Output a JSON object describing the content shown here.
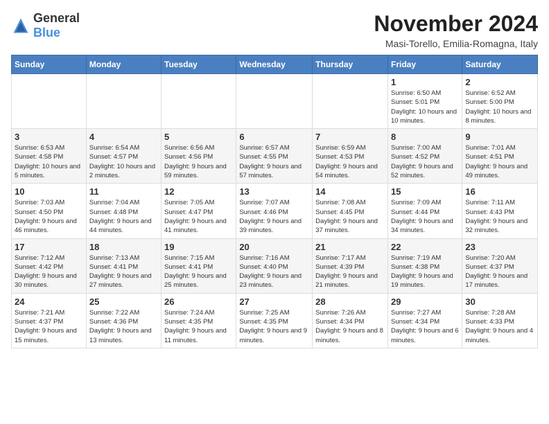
{
  "header": {
    "logo_general": "General",
    "logo_blue": "Blue",
    "month_title": "November 2024",
    "location": "Masi-Torello, Emilia-Romagna, Italy"
  },
  "days_of_week": [
    "Sunday",
    "Monday",
    "Tuesday",
    "Wednesday",
    "Thursday",
    "Friday",
    "Saturday"
  ],
  "weeks": [
    [
      {
        "day": "",
        "info": ""
      },
      {
        "day": "",
        "info": ""
      },
      {
        "day": "",
        "info": ""
      },
      {
        "day": "",
        "info": ""
      },
      {
        "day": "",
        "info": ""
      },
      {
        "day": "1",
        "info": "Sunrise: 6:50 AM\nSunset: 5:01 PM\nDaylight: 10 hours and 10 minutes."
      },
      {
        "day": "2",
        "info": "Sunrise: 6:52 AM\nSunset: 5:00 PM\nDaylight: 10 hours and 8 minutes."
      }
    ],
    [
      {
        "day": "3",
        "info": "Sunrise: 6:53 AM\nSunset: 4:58 PM\nDaylight: 10 hours and 5 minutes."
      },
      {
        "day": "4",
        "info": "Sunrise: 6:54 AM\nSunset: 4:57 PM\nDaylight: 10 hours and 2 minutes."
      },
      {
        "day": "5",
        "info": "Sunrise: 6:56 AM\nSunset: 4:56 PM\nDaylight: 9 hours and 59 minutes."
      },
      {
        "day": "6",
        "info": "Sunrise: 6:57 AM\nSunset: 4:55 PM\nDaylight: 9 hours and 57 minutes."
      },
      {
        "day": "7",
        "info": "Sunrise: 6:59 AM\nSunset: 4:53 PM\nDaylight: 9 hours and 54 minutes."
      },
      {
        "day": "8",
        "info": "Sunrise: 7:00 AM\nSunset: 4:52 PM\nDaylight: 9 hours and 52 minutes."
      },
      {
        "day": "9",
        "info": "Sunrise: 7:01 AM\nSunset: 4:51 PM\nDaylight: 9 hours and 49 minutes."
      }
    ],
    [
      {
        "day": "10",
        "info": "Sunrise: 7:03 AM\nSunset: 4:50 PM\nDaylight: 9 hours and 46 minutes."
      },
      {
        "day": "11",
        "info": "Sunrise: 7:04 AM\nSunset: 4:48 PM\nDaylight: 9 hours and 44 minutes."
      },
      {
        "day": "12",
        "info": "Sunrise: 7:05 AM\nSunset: 4:47 PM\nDaylight: 9 hours and 41 minutes."
      },
      {
        "day": "13",
        "info": "Sunrise: 7:07 AM\nSunset: 4:46 PM\nDaylight: 9 hours and 39 minutes."
      },
      {
        "day": "14",
        "info": "Sunrise: 7:08 AM\nSunset: 4:45 PM\nDaylight: 9 hours and 37 minutes."
      },
      {
        "day": "15",
        "info": "Sunrise: 7:09 AM\nSunset: 4:44 PM\nDaylight: 9 hours and 34 minutes."
      },
      {
        "day": "16",
        "info": "Sunrise: 7:11 AM\nSunset: 4:43 PM\nDaylight: 9 hours and 32 minutes."
      }
    ],
    [
      {
        "day": "17",
        "info": "Sunrise: 7:12 AM\nSunset: 4:42 PM\nDaylight: 9 hours and 30 minutes."
      },
      {
        "day": "18",
        "info": "Sunrise: 7:13 AM\nSunset: 4:41 PM\nDaylight: 9 hours and 27 minutes."
      },
      {
        "day": "19",
        "info": "Sunrise: 7:15 AM\nSunset: 4:41 PM\nDaylight: 9 hours and 25 minutes."
      },
      {
        "day": "20",
        "info": "Sunrise: 7:16 AM\nSunset: 4:40 PM\nDaylight: 9 hours and 23 minutes."
      },
      {
        "day": "21",
        "info": "Sunrise: 7:17 AM\nSunset: 4:39 PM\nDaylight: 9 hours and 21 minutes."
      },
      {
        "day": "22",
        "info": "Sunrise: 7:19 AM\nSunset: 4:38 PM\nDaylight: 9 hours and 19 minutes."
      },
      {
        "day": "23",
        "info": "Sunrise: 7:20 AM\nSunset: 4:37 PM\nDaylight: 9 hours and 17 minutes."
      }
    ],
    [
      {
        "day": "24",
        "info": "Sunrise: 7:21 AM\nSunset: 4:37 PM\nDaylight: 9 hours and 15 minutes."
      },
      {
        "day": "25",
        "info": "Sunrise: 7:22 AM\nSunset: 4:36 PM\nDaylight: 9 hours and 13 minutes."
      },
      {
        "day": "26",
        "info": "Sunrise: 7:24 AM\nSunset: 4:35 PM\nDaylight: 9 hours and 11 minutes."
      },
      {
        "day": "27",
        "info": "Sunrise: 7:25 AM\nSunset: 4:35 PM\nDaylight: 9 hours and 9 minutes."
      },
      {
        "day": "28",
        "info": "Sunrise: 7:26 AM\nSunset: 4:34 PM\nDaylight: 9 hours and 8 minutes."
      },
      {
        "day": "29",
        "info": "Sunrise: 7:27 AM\nSunset: 4:34 PM\nDaylight: 9 hours and 6 minutes."
      },
      {
        "day": "30",
        "info": "Sunrise: 7:28 AM\nSunset: 4:33 PM\nDaylight: 9 hours and 4 minutes."
      }
    ]
  ]
}
